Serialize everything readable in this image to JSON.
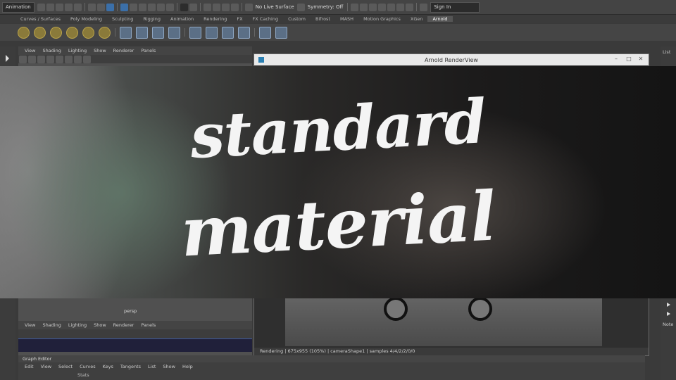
{
  "statusline": {
    "mode": "Animation",
    "live_surface": "No Live Surface",
    "symmetry": "Symmetry: Off",
    "signin": "Sign In"
  },
  "shelf_tabs": [
    "Curves / Surfaces",
    "Poly Modeling",
    "Sculpting",
    "Rigging",
    "Animation",
    "Rendering",
    "FX",
    "FX Caching",
    "Custom",
    "Bifrost",
    "MASH",
    "Motion Graphics",
    "XGen",
    "Arnold"
  ],
  "active_shelf_tab": "Arnold",
  "viewport_menu": [
    "View",
    "Shading",
    "Lighting",
    "Show",
    "Renderer",
    "Panels"
  ],
  "viewport_camera": "persp",
  "renderview": {
    "title": "Arnold RenderView",
    "menu": [
      "View",
      "Shading",
      "Lighting",
      "Show",
      "Renderer",
      "Panels"
    ],
    "status": "Rendering | 675x955 (105%) | cameraShape1 | samples 4/4/2/2/0/0"
  },
  "graph_editor": {
    "title": "Graph Editor",
    "menu": [
      "Edit",
      "View",
      "Select",
      "Curves",
      "Keys",
      "Tangents",
      "List",
      "Show",
      "Help"
    ],
    "stats_label": "Stats"
  },
  "right_panel": {
    "list_label": "List",
    "notes_label": "Note"
  },
  "overlay": {
    "line1": "standard",
    "line2": "material"
  }
}
